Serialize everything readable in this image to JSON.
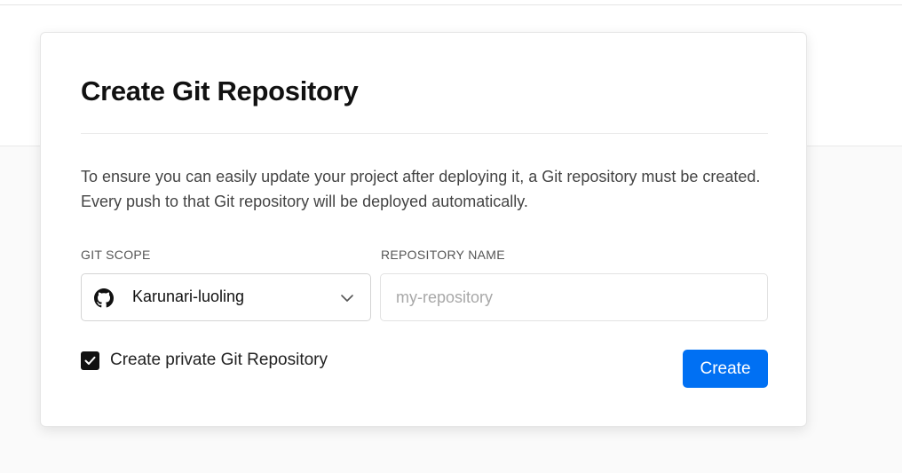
{
  "dialog": {
    "title": "Create Git Repository",
    "description": "To ensure you can easily update your project after deploying it, a Git repository must be created. Every push to that Git repository will be deployed automatically."
  },
  "form": {
    "scope_label": "GIT SCOPE",
    "scope_value": "Karunari-luoling",
    "scope_icon": "github-icon",
    "repo_label": "REPOSITORY NAME",
    "repo_placeholder": "my-repository",
    "repo_value": "",
    "private_label": "Create private Git Repository",
    "private_checked": true,
    "create_label": "Create"
  },
  "colors": {
    "primary": "#0070f3",
    "checkbox": "#111111",
    "background": "#fafafa"
  }
}
